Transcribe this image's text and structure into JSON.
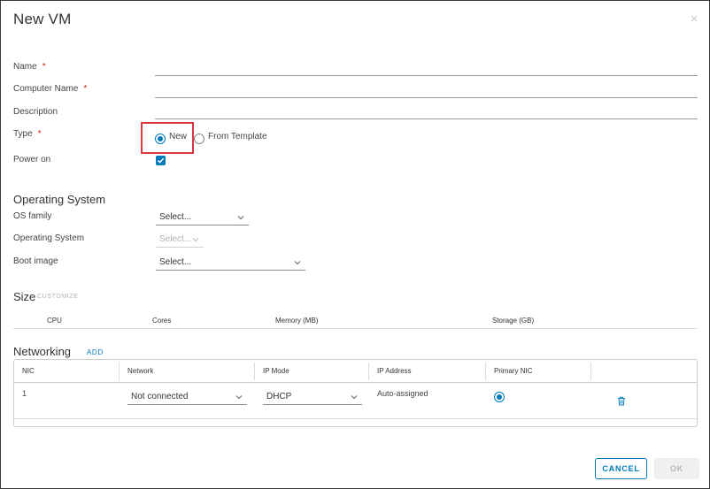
{
  "dialog": {
    "title": "New VM",
    "close_glyph": "×"
  },
  "form": {
    "name_label": "Name",
    "computer_name_label": "Computer Name",
    "description_label": "Description",
    "type_label": "Type",
    "power_on_label": "Power on",
    "required_mark": "*",
    "type_options": [
      "New",
      "From Template"
    ],
    "type_selected": "New",
    "power_on_checked": true
  },
  "os": {
    "section_title": "Operating System",
    "os_family_label": "OS family",
    "os_family_value": "Select...",
    "operating_system_label": "Operating System",
    "operating_system_value": "Select...",
    "boot_image_label": "Boot image",
    "boot_image_value": "Select..."
  },
  "size": {
    "section_title": "Size",
    "customize_label": "CUSTOMIZE",
    "columns": [
      "CPU",
      "Cores",
      "Memory (MB)",
      "Storage (GB)"
    ]
  },
  "networking": {
    "section_title": "Networking",
    "add_label": "ADD",
    "columns": [
      "NIC",
      "Network",
      "IP Mode",
      "IP Address",
      "Primary NIC"
    ],
    "rows": [
      {
        "nic": "1",
        "network": "Not connected",
        "ip_mode": "DHCP",
        "ip_address": "Auto-assigned",
        "primary": true
      }
    ]
  },
  "footer": {
    "cancel_label": "CANCEL",
    "ok_label": "OK"
  },
  "colors": {
    "accent": "#0079b8",
    "highlight_box": "#d9363e",
    "required": "#c21d00"
  }
}
